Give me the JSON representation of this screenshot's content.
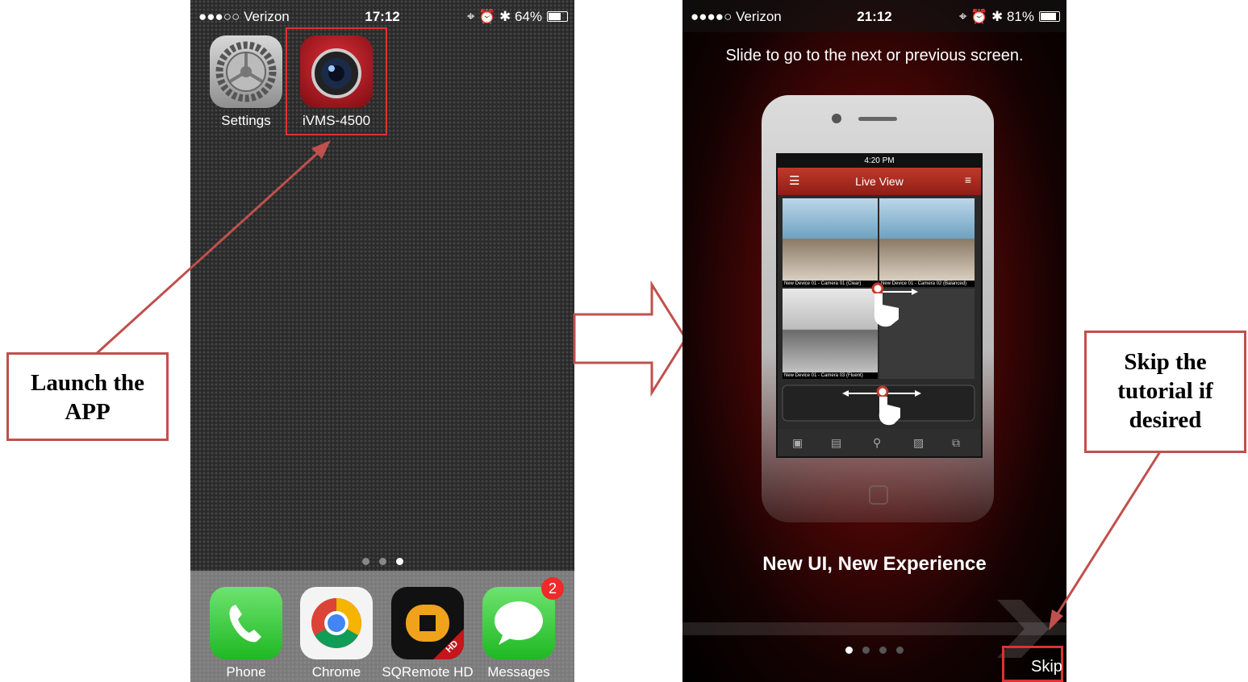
{
  "left_phone": {
    "status": {
      "carrier": "●●●○○ Verizon",
      "time": "17:12",
      "battery": "64%",
      "battery_level": 0.64
    },
    "apps": [
      {
        "label": "Settings",
        "icon": "settings-icon"
      },
      {
        "label": "iVMS-4500",
        "icon": "camera-lens-icon"
      }
    ],
    "page_dots": 3,
    "active_page": 2,
    "dock": [
      {
        "label": "Phone",
        "icon": "phone-icon"
      },
      {
        "label": "Chrome",
        "icon": "chrome-icon"
      },
      {
        "label": "SQRemote HD",
        "icon": "sqremote-icon",
        "badge_text": "HD"
      },
      {
        "label": "Messages",
        "icon": "message-bubble-icon",
        "badge": "2"
      }
    ]
  },
  "right_phone": {
    "status": {
      "carrier": "●●●●○ Verizon",
      "time": "21:12",
      "battery": "81%",
      "battery_level": 0.81
    },
    "hint": "Slide to go to the next or previous screen.",
    "mock_phone": {
      "time": "4:20 PM",
      "title": "Live View",
      "cameras": [
        "New Device 01 - Camera 01 (Clear)",
        "New Device 01 - Camera 02 (Balanced)",
        "New Device 01 - Camera 03 (Fluent)"
      ]
    },
    "tagline": "New UI, New Experience",
    "page_dots": 4,
    "active_page": 0,
    "skip": "Skip"
  },
  "callouts": {
    "launch": "Launch the APP",
    "skip": "Skip the tutorial if desired"
  },
  "colors": {
    "callout_red": "#c0504d",
    "dock_bg": "#bdbdbd",
    "tutorial_red": "#7a0a0a"
  }
}
